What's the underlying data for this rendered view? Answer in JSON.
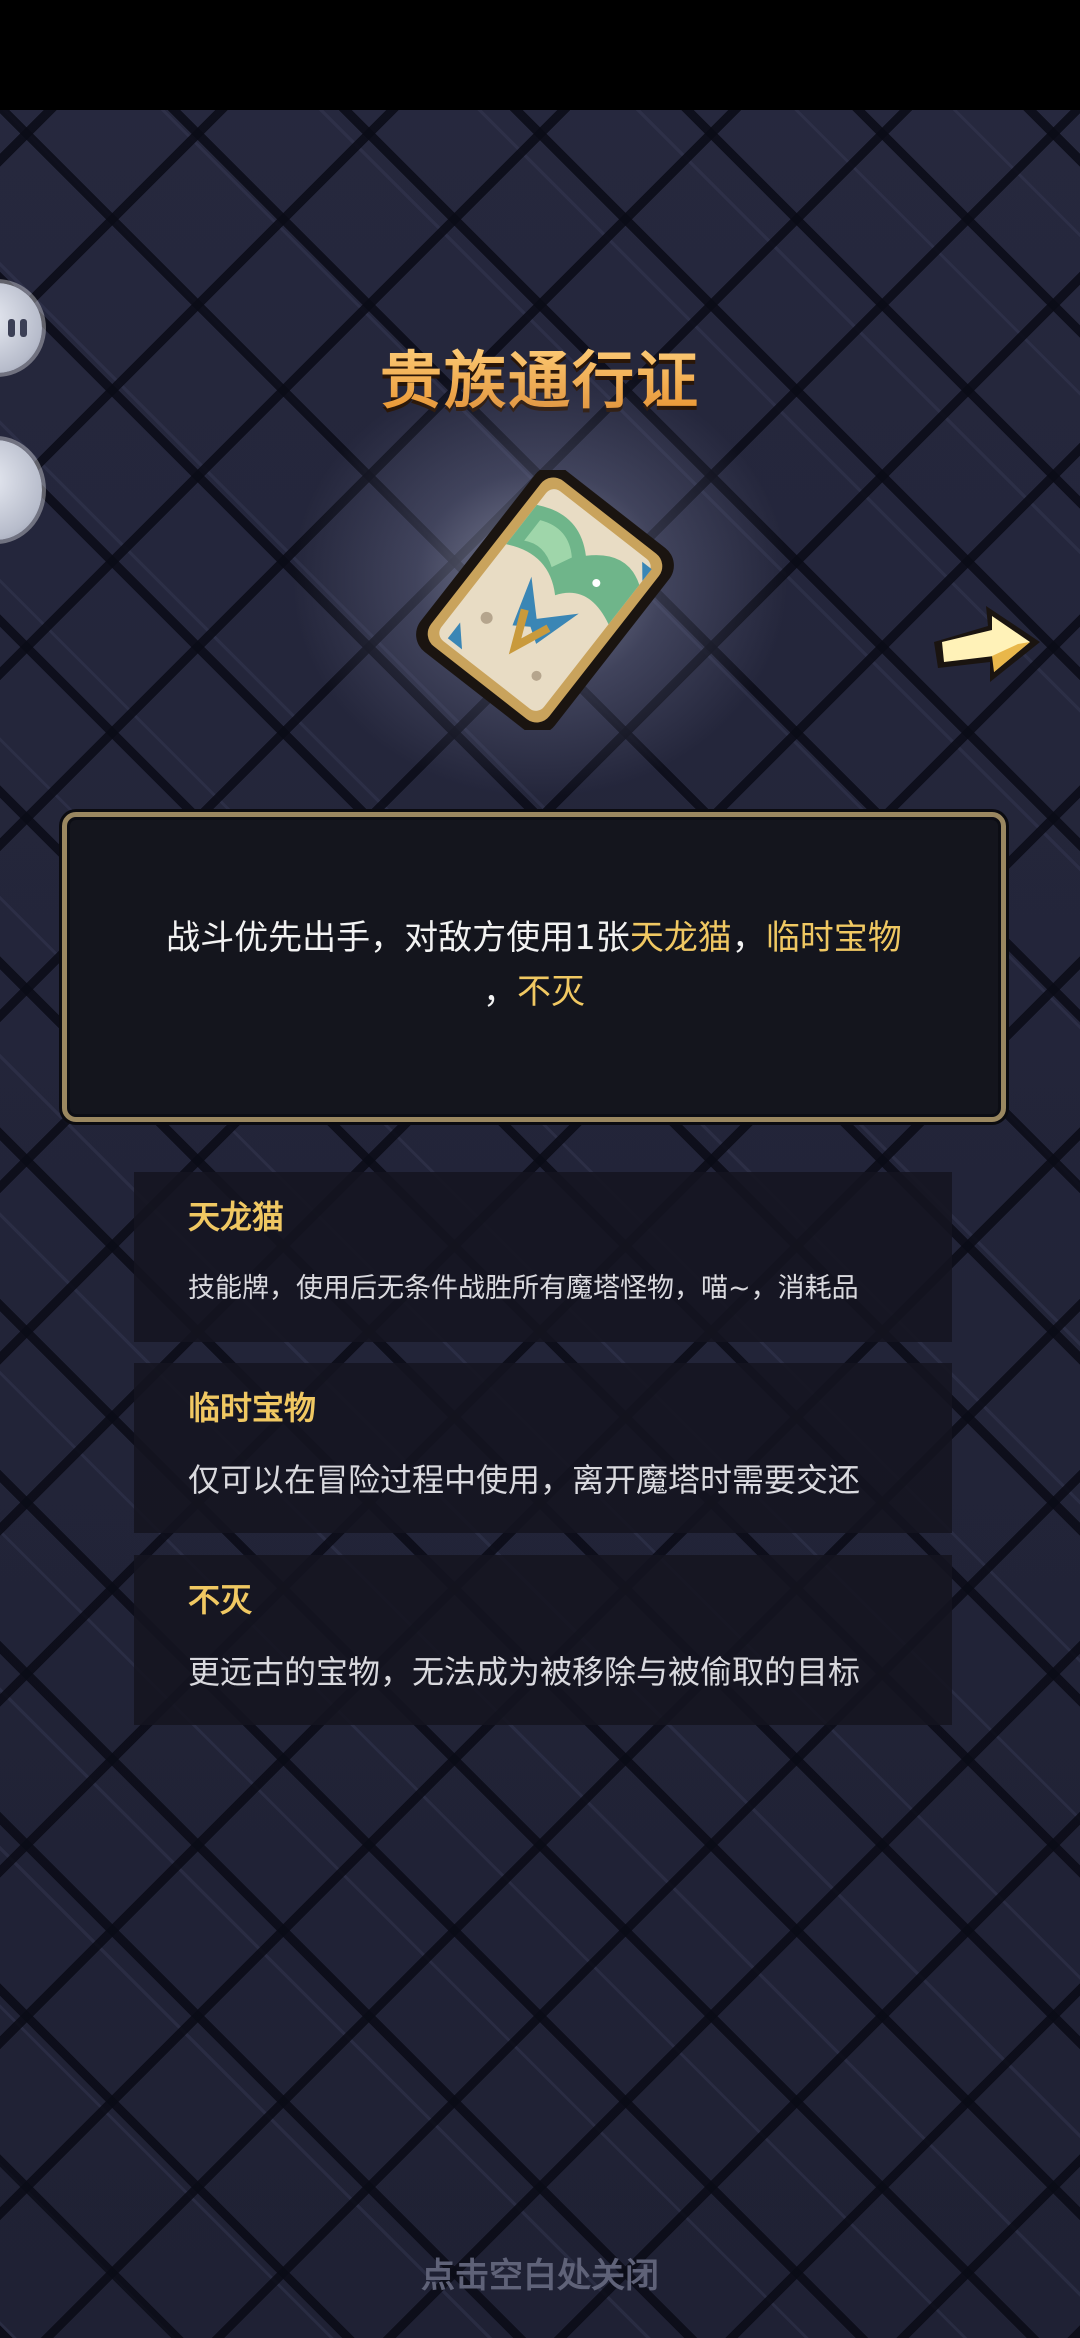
{
  "item": {
    "name": "贵族通行证",
    "description": {
      "text_1": "战斗优先出手，对敌方使用1张",
      "keyword_1": "天龙猫",
      "sep_1": "，",
      "keyword_2": "临时宝物",
      "line2_prefix": "，",
      "keyword_3": "不灭"
    }
  },
  "keywords": [
    {
      "title": "天龙猫",
      "desc": "技能牌，使用后无条件战胜所有魔塔怪物，喵~，消耗品"
    },
    {
      "title": "临时宝物",
      "desc": "仅可以在冒险过程中使用，离开魔塔时需要交还"
    },
    {
      "title": "不灭",
      "desc": "更远古的宝物，无法成为被移除与被偷取的目标"
    }
  ],
  "close_hint": "点击空白处关闭",
  "colors": {
    "title": "#f5b34a",
    "highlight": "#f0c862",
    "panel_border": "#9a8760"
  },
  "icons": {
    "item": "card-pass-icon",
    "next": "next-arrow-icon"
  }
}
